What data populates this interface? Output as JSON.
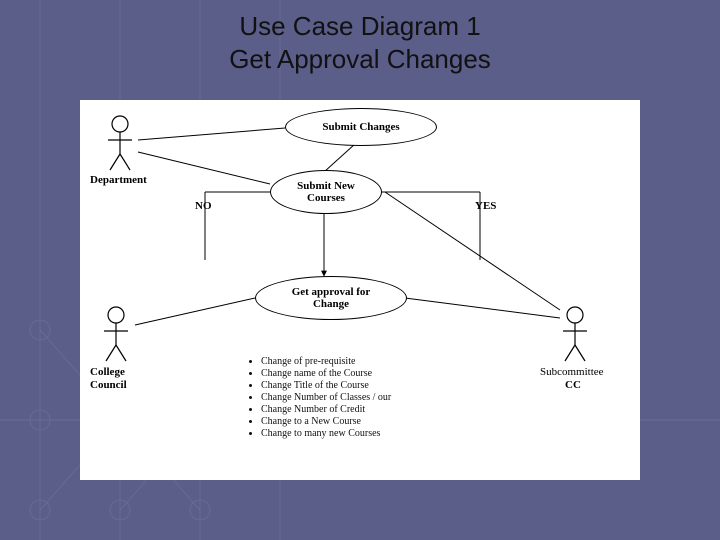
{
  "title_line1": "Use Case Diagram 1",
  "title_line2": "Get Approval Changes",
  "actors": {
    "department": "Department",
    "college_council_l1": "College",
    "college_council_l2": "Council",
    "subcommittee": "Subcommittee",
    "cc": "CC"
  },
  "usecases": {
    "submit_changes": "Submit Changes",
    "submit_new_courses_l1": "Submit New",
    "submit_new_courses_l2": "Courses",
    "get_approval_l1": "Get approval for",
    "get_approval_l2": "Change"
  },
  "decisions": {
    "no": "NO",
    "yes": "YES"
  },
  "changes": [
    "Change of pre-requisite",
    "Change name of the Course",
    "Change Title of the Course",
    "Change Number of Classes / our",
    "Change Number of Credit",
    "Change to a New Course",
    "Change to many new Courses"
  ]
}
